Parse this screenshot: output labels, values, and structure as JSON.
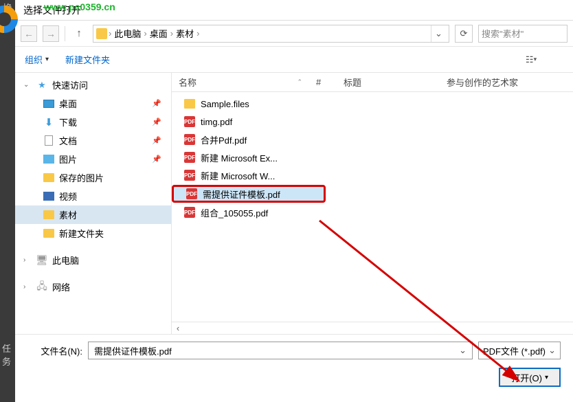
{
  "titlebar": {
    "title": "选择文件打开"
  },
  "watermark": "www.pc0359.cn",
  "darkstrip": {
    "top": "换",
    "bottom": "任\n务"
  },
  "breadcrumb": {
    "items": [
      "此电脑",
      "桌面",
      "素材"
    ]
  },
  "search": {
    "placeholder": "搜索\"素材\""
  },
  "toolbar": {
    "organize": "组织",
    "newfolder": "新建文件夹"
  },
  "columns": {
    "name": "名称",
    "num": "#",
    "title": "标题",
    "artist": "参与创作的艺术家"
  },
  "tree": {
    "quick": "快速访问",
    "desktop": "桌面",
    "downloads": "下载",
    "docs": "文档",
    "pics": "图片",
    "saved": "保存的图片",
    "video": "视频",
    "material": "素材",
    "newfolder": "新建文件夹",
    "thispc": "此电脑",
    "network": "网络"
  },
  "files": [
    {
      "name": "Sample.files",
      "type": "folder"
    },
    {
      "name": "timg.pdf",
      "type": "pdf"
    },
    {
      "name": "合并Pdf.pdf",
      "type": "pdf"
    },
    {
      "name": "新建 Microsoft Ex...",
      "type": "pdf"
    },
    {
      "name": "新建 Microsoft W...",
      "type": "pdf"
    },
    {
      "name": "需提供证件模板.pdf",
      "type": "pdf",
      "highlight": true,
      "selected": true
    },
    {
      "name": "组合_105055.pdf",
      "type": "pdf"
    }
  ],
  "bottom": {
    "filename_label": "文件名(N):",
    "filename_value": "需提供证件模板.pdf",
    "filter": "PDF文件 (*.pdf)",
    "open": "打开(O)"
  }
}
